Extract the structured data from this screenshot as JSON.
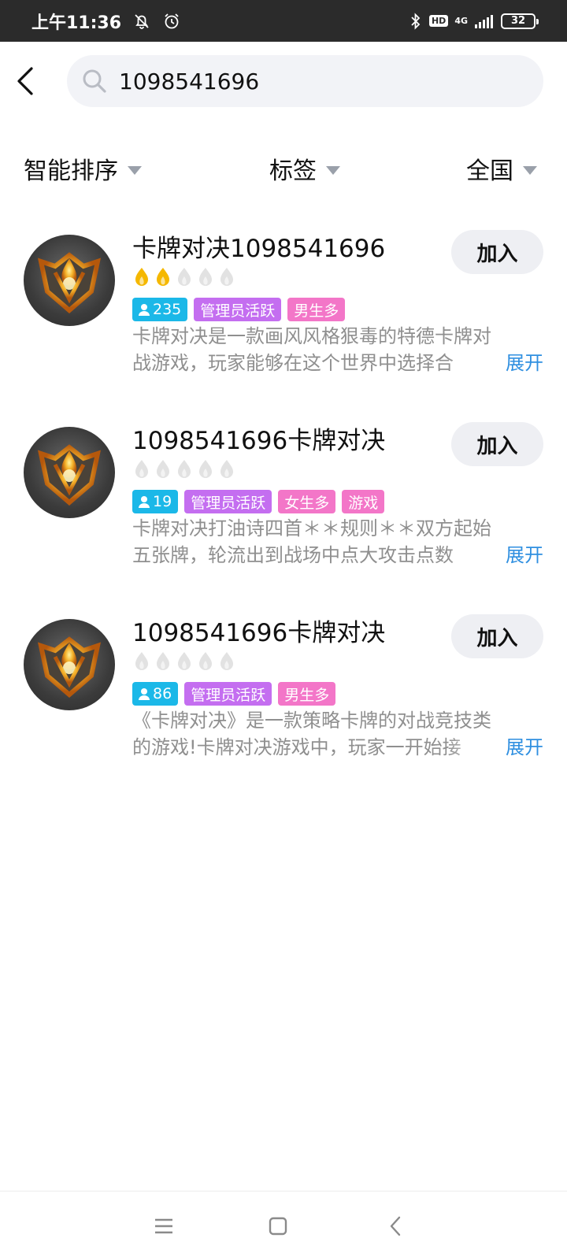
{
  "status_bar": {
    "time": "上午11:36",
    "network": "4G",
    "hd": "HD",
    "battery": "32"
  },
  "search": {
    "value": "1098541696",
    "placeholder": ""
  },
  "filters": [
    {
      "label": "智能排序"
    },
    {
      "label": "标签"
    },
    {
      "label": "全国"
    }
  ],
  "results": [
    {
      "title": "卡牌对决1098541696",
      "flames_lit": 2,
      "flames_total": 5,
      "members": "235",
      "tags": [
        "管理员活跃",
        "男生多"
      ],
      "desc_line1": "卡牌对决是一款画风风格狠毒的特德卡牌对",
      "desc_line2": "战游戏，玩家能够在这个世界中选择合",
      "expand": "展开",
      "join": "加入"
    },
    {
      "title": "1098541696卡牌对决",
      "flames_lit": 0,
      "flames_total": 5,
      "members": "19",
      "tags": [
        "管理员活跃",
        "女生多",
        "游戏"
      ],
      "desc_line1": "卡牌对决打油诗四首＊＊规则＊＊双方起始",
      "desc_line2": "五张牌，轮流出到战场中点大攻击点数",
      "expand": "展开",
      "join": "加入"
    },
    {
      "title": "1098541696卡牌对决",
      "flames_lit": 0,
      "flames_total": 5,
      "members": "86",
      "tags": [
        "管理员活跃",
        "男生多"
      ],
      "desc_line1": "《卡牌对决》是一款策略卡牌的对战竞技类",
      "desc_line2": "的游戏!卡牌对决游戏中，玩家一开始接",
      "expand": "展开",
      "join": "加入"
    }
  ],
  "colors": {
    "members_tag": "#1bb8e8",
    "admin_tag": "#c46ef0",
    "pink_tag": "#f376c8",
    "expand_link": "#2f8fe0",
    "flame_lit": "#f5b800",
    "flame_unlit": "#e2e2e2"
  }
}
